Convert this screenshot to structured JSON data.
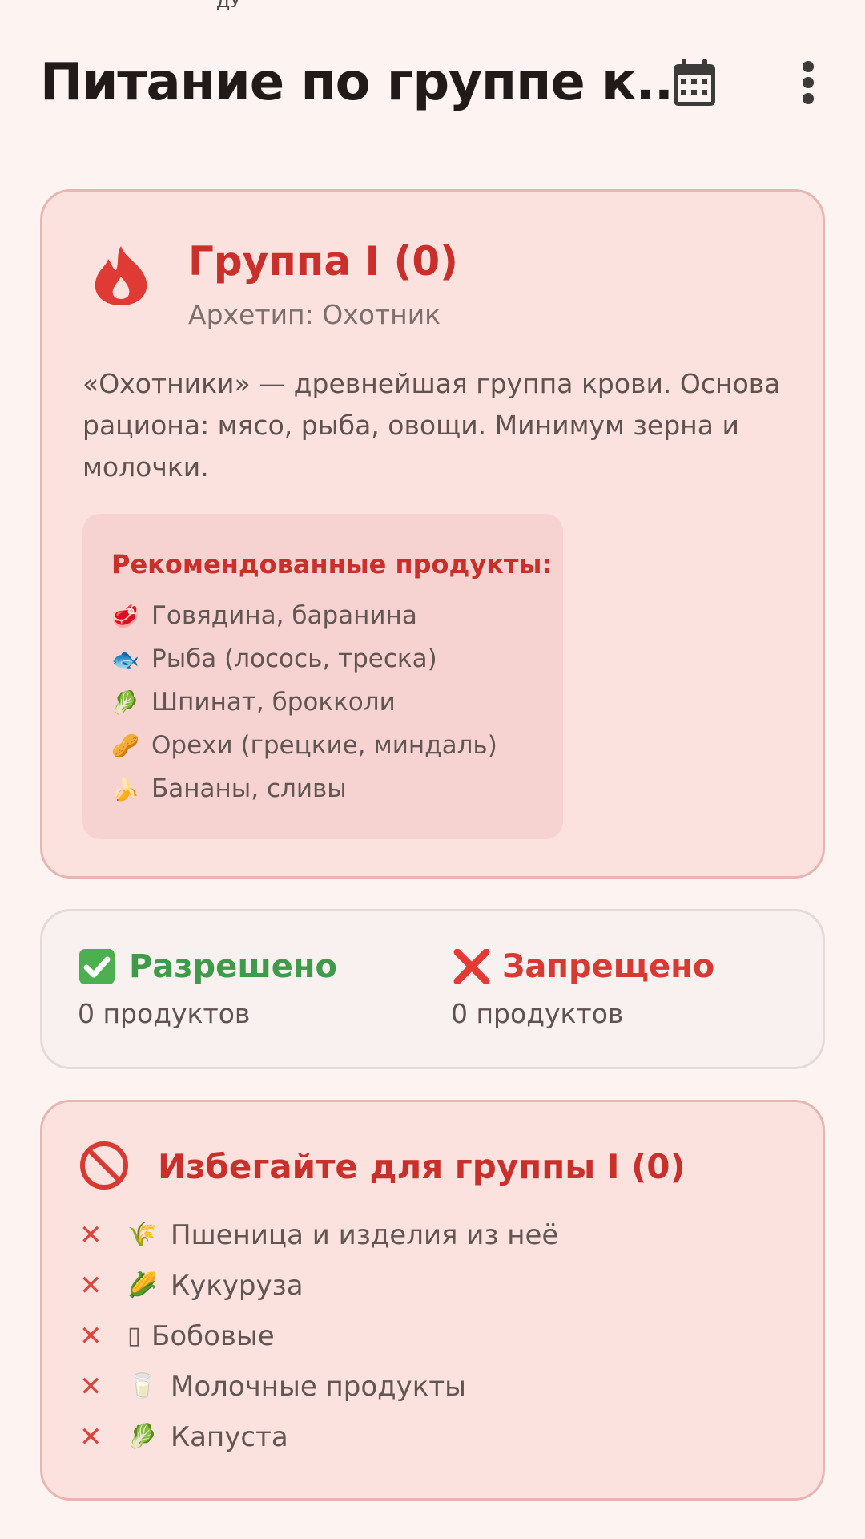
{
  "status": {
    "fragment": "ДУ"
  },
  "appbar": {
    "title": "Питание по группе к...",
    "icons": {
      "calendar": "calendar-icon",
      "more": "more-vert-icon"
    }
  },
  "group": {
    "title": "Группа I (0)",
    "archetype": "Архетип: Охотник",
    "description": "«Охотники» — древнейшая группа крови. Основа рациона: мясо, рыба, овощи. Минимум зерна и молочки.",
    "icon": "fire-icon",
    "recommended_title": "Рекомендованные продукты:",
    "recommended": [
      {
        "emoji": "🥩",
        "label": "Говядина, баранина"
      },
      {
        "emoji": "🐟",
        "label": "Рыба (лосось, треска)"
      },
      {
        "emoji": "🥬",
        "label": "Шпинат, брокколи"
      },
      {
        "emoji": "🥜",
        "label": "Орехи (грецкие, миндаль)"
      },
      {
        "emoji": "🍌",
        "label": "Бананы, сливы"
      }
    ]
  },
  "stats": {
    "allowed": {
      "label": "Разрешено",
      "count": "0 продуктов",
      "color": "#3f9a4a"
    },
    "forbidden": {
      "label": "Запрещено",
      "count": "0 продуктов",
      "color": "#d63a33"
    }
  },
  "avoid": {
    "title": "Избегайте для группы I (0)",
    "icon": "block-icon",
    "items": [
      {
        "emoji": "🌾",
        "label": "Пшеница и изделия из неё"
      },
      {
        "emoji": "🌽",
        "label": "Кукуруза"
      },
      {
        "emoji": "▯",
        "label": "Бобовые"
      },
      {
        "emoji": "🥛",
        "label": "Молочные продукты"
      },
      {
        "emoji": "🥬",
        "label": "Капуста"
      }
    ],
    "mark": "✕"
  },
  "colors": {
    "accent": "#c9302c",
    "card_bg": "#fbe2df",
    "page_bg": "#fdf3f1"
  }
}
